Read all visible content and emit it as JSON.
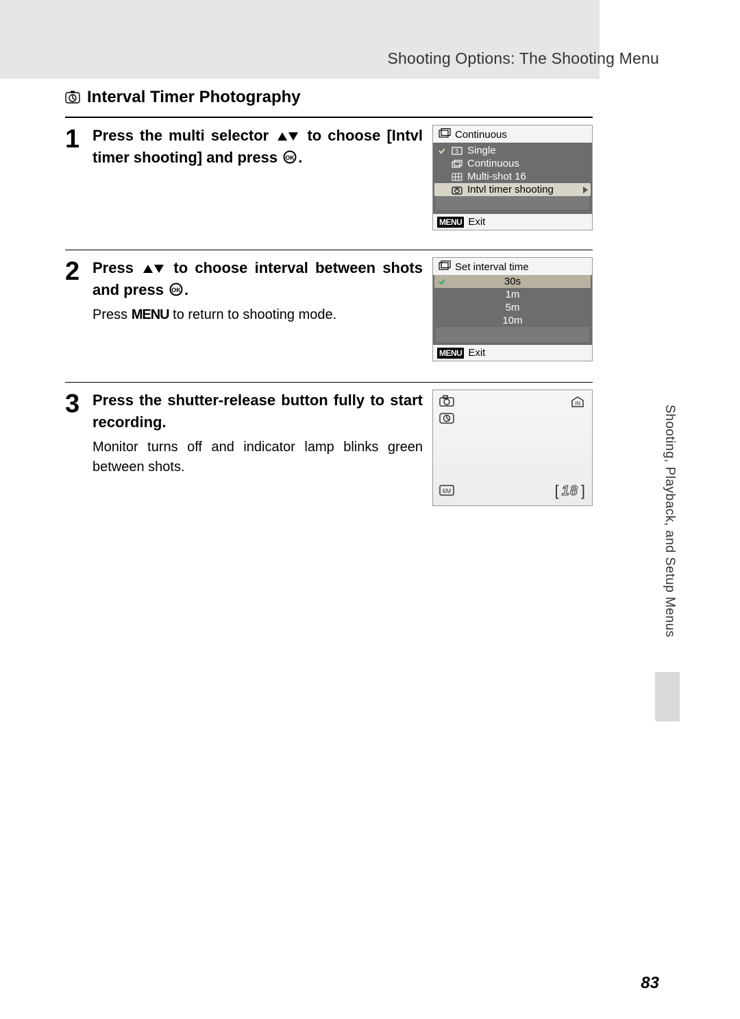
{
  "header": {
    "running_title": "Shooting Options: The Shooting Menu"
  },
  "section": {
    "title": "Interval Timer Photography"
  },
  "steps": [
    {
      "num": "1",
      "main_a": "Press the multi selector ",
      "main_b": " to choose [Intvl timer shooting] and press ",
      "main_c": "."
    },
    {
      "num": "2",
      "main_a": "Press ",
      "main_b": " to choose interval between shots and press ",
      "main_c": ".",
      "sub_a": "Press ",
      "sub_b": " to return to shooting mode."
    },
    {
      "num": "3",
      "main": "Press the shutter-release button fully to start recording.",
      "sub": "Monitor turns off and indicator lamp blinks green between shots."
    }
  ],
  "screen_continuous": {
    "title": "Continuous",
    "items": [
      {
        "label": "Single",
        "highlight": false,
        "checked": true
      },
      {
        "label": "Continuous",
        "highlight": false,
        "checked": false
      },
      {
        "label": "Multi-shot 16",
        "highlight": false,
        "checked": false
      },
      {
        "label": "Intvl timer shooting",
        "highlight": true,
        "checked": false
      }
    ],
    "footer_menu": "MENU",
    "footer_exit": "Exit"
  },
  "screen_interval": {
    "title": "Set interval time",
    "items": [
      {
        "label": "30s",
        "highlight": true,
        "checked": true
      },
      {
        "label": "1m",
        "highlight": false,
        "checked": false
      },
      {
        "label": "5m",
        "highlight": false,
        "checked": false
      },
      {
        "label": "10m",
        "highlight": false,
        "checked": false
      }
    ],
    "footer_menu": "MENU",
    "footer_exit": "Exit"
  },
  "liveview": {
    "size_label": "6M",
    "in_label": "IN",
    "count": "18"
  },
  "side_tab": "Shooting, Playback, and Setup Menus",
  "page_number": "83",
  "glyphs": {
    "menu_word": "MENU"
  }
}
